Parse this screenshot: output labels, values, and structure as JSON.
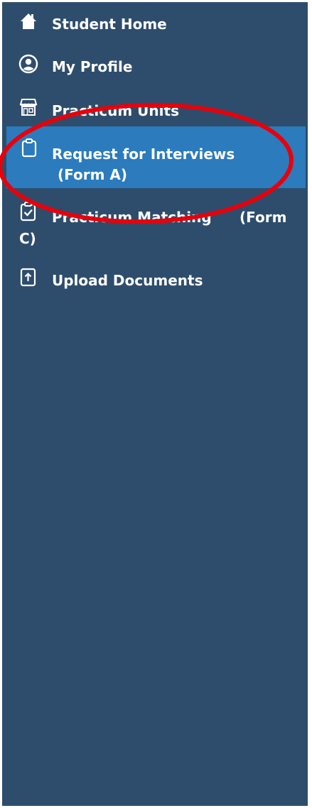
{
  "sidebar": {
    "bg_color": "#2e4d6c",
    "active_color": "#2b7bbd",
    "items": [
      {
        "label": "Student Home",
        "icon": "home-icon"
      },
      {
        "label": "My Profile",
        "icon": "user-circle-icon"
      },
      {
        "label": "Practicum Units",
        "icon": "store-icon"
      },
      {
        "label_line1": "Request for Interviews",
        "label_line2": "(Form A)",
        "icon": "clipboard-icon",
        "active": true
      },
      {
        "label_line1": "Practicum Matching",
        "label_form": "(Form",
        "label_line2": "C)",
        "icon": "clipboard-check-icon"
      },
      {
        "label": "Upload Documents",
        "icon": "upload-file-icon"
      }
    ]
  },
  "annotation": {
    "shape": "ellipse",
    "color": "#e8000b"
  }
}
